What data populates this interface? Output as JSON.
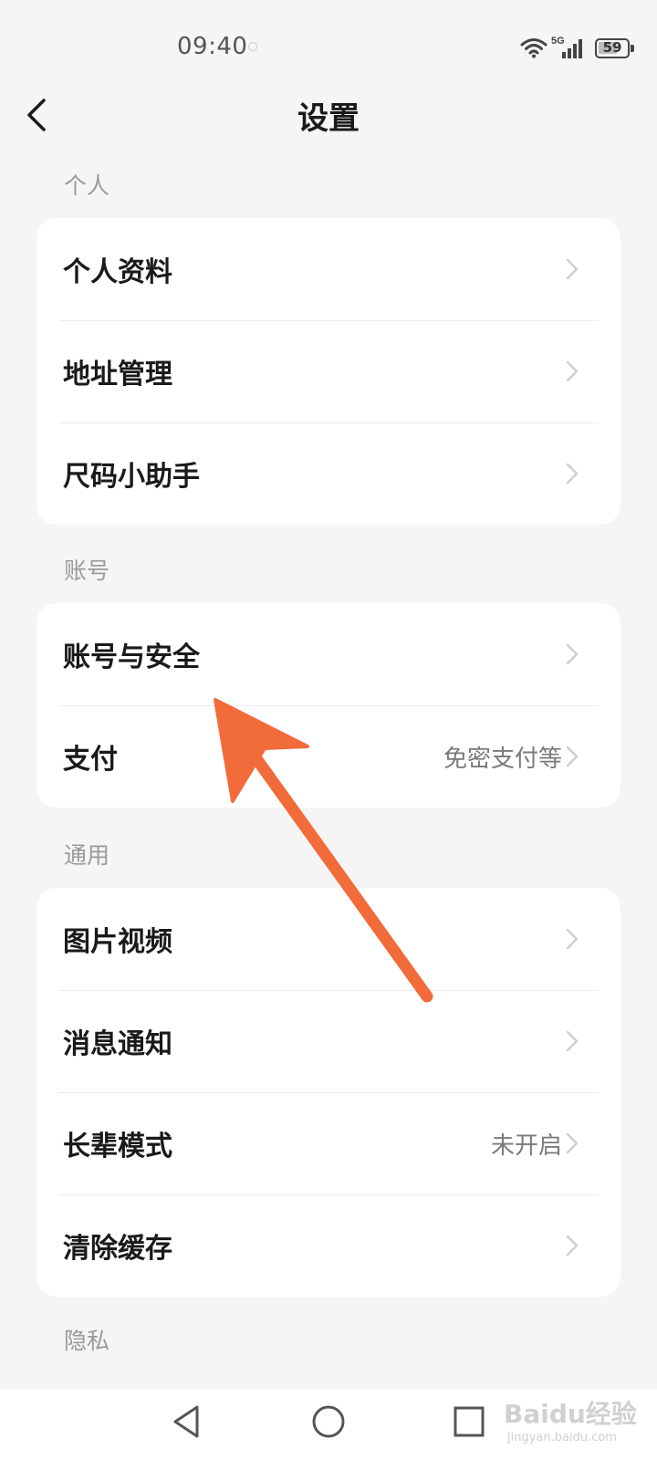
{
  "status_bar": {
    "time": "09:40",
    "network": "5G",
    "battery": "59"
  },
  "nav": {
    "title": "设置"
  },
  "sections": [
    {
      "header": "个人",
      "items": [
        {
          "label": "个人资料",
          "value": ""
        },
        {
          "label": "地址管理",
          "value": ""
        },
        {
          "label": "尺码小助手",
          "value": ""
        }
      ]
    },
    {
      "header": "账号",
      "items": [
        {
          "label": "账号与安全",
          "value": ""
        },
        {
          "label": "支付",
          "value": "免密支付等"
        }
      ]
    },
    {
      "header": "通用",
      "items": [
        {
          "label": "图片视频",
          "value": ""
        },
        {
          "label": "消息通知",
          "value": ""
        },
        {
          "label": "长辈模式",
          "value": "未开启"
        },
        {
          "label": "清除缓存",
          "value": ""
        }
      ]
    },
    {
      "header": "隐私",
      "items": []
    }
  ],
  "watermark": {
    "brand": "Baidu经验",
    "url": "jingyan.baidu.com"
  },
  "colors": {
    "background": "#f5f5f5",
    "card": "#ffffff",
    "arrow": "#f26b3a",
    "text_primary": "#1a1a1a",
    "text_secondary": "#9a9a9a"
  },
  "icons": {
    "back": "chevron-left-icon",
    "row": "chevron-right-icon",
    "nav_back": "triangle-back-icon",
    "nav_home": "circle-home-icon",
    "nav_recent": "square-recent-icon"
  }
}
